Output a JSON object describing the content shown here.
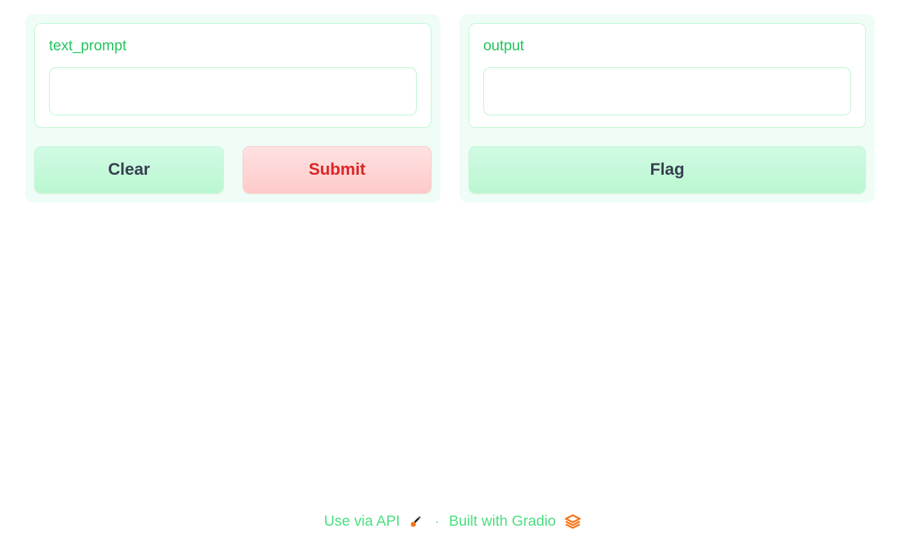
{
  "inputs": {
    "text_prompt": {
      "label": "text_prompt",
      "value": ""
    }
  },
  "outputs": {
    "output": {
      "label": "output",
      "value": ""
    }
  },
  "buttons": {
    "clear": "Clear",
    "submit": "Submit",
    "flag": "Flag"
  },
  "footer": {
    "api_link": "Use via API",
    "separator": "·",
    "built_with": "Built with Gradio",
    "api_icon": "rocket-icon",
    "gradio_icon": "gradio-logo-icon"
  },
  "colors": {
    "accent_green": "#22c55e",
    "panel_bg": "#f0fdf6",
    "primary_red": "#dc2626",
    "icon_orange": "#f97316"
  }
}
